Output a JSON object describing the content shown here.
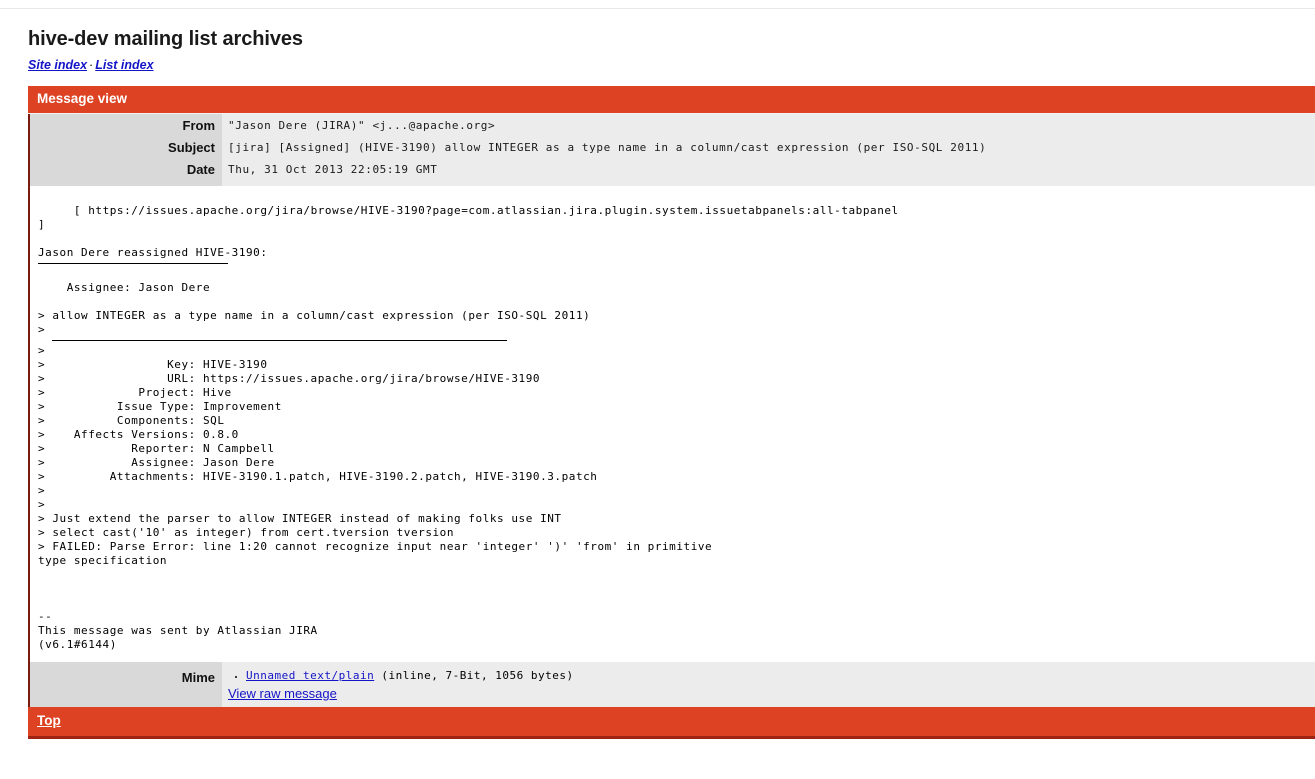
{
  "page": {
    "title": "hive-dev mailing list archives",
    "nav": {
      "site_index": "Site index",
      "separator": "·",
      "list_index": "List index"
    }
  },
  "message_view": {
    "header_bar_label": "Message view",
    "footer_bar_label": "Top",
    "accent_color": "#dd4222",
    "accent_dark": "#9e2413",
    "link_color": "#1414c8",
    "headers": [
      {
        "label": "From",
        "value": "\"Jason Dere (JIRA)\" <j...@apache.org>"
      },
      {
        "label": "Subject",
        "value": "[jira] [Assigned] (HIVE-3190) allow INTEGER as a type name in a column/cast expression (per ISO-SQL 2011)"
      },
      {
        "label": "Date",
        "value": "Thu, 31 Oct 2013 22:05:19 GMT"
      }
    ],
    "body": {
      "part1": "     [ https://issues.apache.org/jira/browse/HIVE-3190?page=com.atlassian.jira.plugin.system.issuetabpanels:all-tabpanel\n]\n\nJason Dere reassigned HIVE-3190:",
      "part2": "\n    Assignee: Jason Dere\n\n> allow INTEGER as a type name in a column/cast expression (per ISO-SQL 2011)\n>",
      "part3": ">\n>                 Key: HIVE-3190\n>                 URL: https://issues.apache.org/jira/browse/HIVE-3190\n>             Project: Hive\n>          Issue Type: Improvement\n>          Components: SQL\n>    Affects Versions: 0.8.0\n>            Reporter: N Campbell\n>            Assignee: Jason Dere\n>         Attachments: HIVE-3190.1.patch, HIVE-3190.2.patch, HIVE-3190.3.patch\n>\n>\n> Just extend the parser to allow INTEGER instead of making folks use INT\n> select cast('10' as integer) from cert.tversion tversion\n> FAILED: Parse Error: line 1:20 cannot recognize input near 'integer' ')' 'from' in primitive\ntype specification\n\n\n\n--\nThis message was sent by Atlassian JIRA\n(v6.1#6144)"
    },
    "mime": {
      "label": "Mime",
      "attachment_link": "Unnamed text/plain",
      "attachment_meta": " (inline, 7-Bit, 1056 bytes)",
      "raw_message_link": "View raw message"
    }
  }
}
